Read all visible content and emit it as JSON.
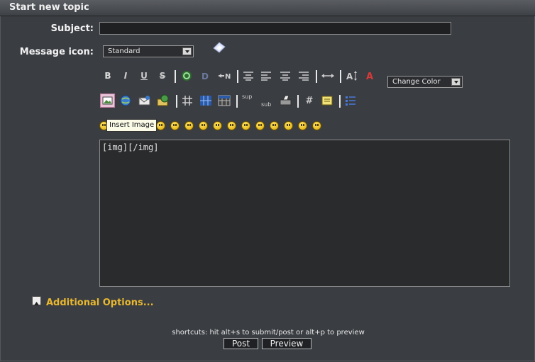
{
  "header": {
    "title": "Start new topic"
  },
  "form": {
    "subject_label": "Subject:",
    "subject_value": "",
    "icon_label": "Message icon:",
    "icon_selected": "Standard",
    "change_color_label": "Change Color",
    "message_text": "[img][/img]",
    "tooltip": "Insert Image",
    "additional_options": "Additional Options...",
    "shortcuts": "shortcuts: hit alt+s to submit/post or alt+p to preview",
    "post_label": "Post",
    "preview_label": "Preview"
  },
  "toolbar": {
    "bold": "B",
    "italic": "I",
    "underline": "U",
    "strike": "S",
    "sup": "sup",
    "sub": "sub",
    "hash": "#"
  },
  "colors": {
    "background": "#3a3d42",
    "accent": "#e8b830"
  }
}
